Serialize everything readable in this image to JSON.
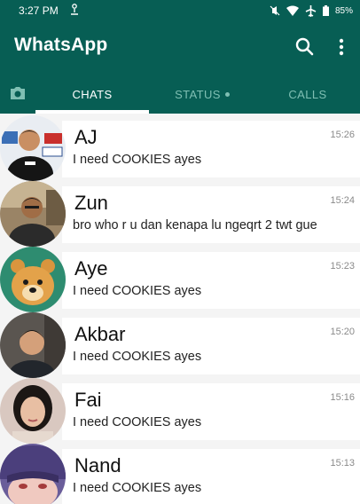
{
  "status_bar": {
    "time": "3:27 PM",
    "battery": "85%",
    "icons": [
      "notification-icon",
      "mute-icon",
      "wifi-icon",
      "airplane-icon",
      "battery-icon"
    ]
  },
  "app_bar": {
    "title": "WhatsApp",
    "actions": [
      "search-icon",
      "more-options-icon"
    ]
  },
  "tabs": {
    "camera_icon": "camera-icon",
    "chats": "CHATS",
    "status": "STATUS",
    "calls": "CALLS",
    "active": "CHATS"
  },
  "colors": {
    "header": "#075e54",
    "active_tab": "#ffffff",
    "inactive_tab": "#7fbfb3",
    "timestamp": "#8a8a8a"
  },
  "chats": [
    {
      "name": "AJ",
      "message": "I need COOKIES ayes",
      "time": "15:26"
    },
    {
      "name": "Zun",
      "message": "bro who r u dan kenapa lu ngeqrt 2 twt gue",
      "time": "15:24"
    },
    {
      "name": "Aye",
      "message": "I need COOKIES ayes",
      "time": "15:23"
    },
    {
      "name": "Akbar",
      "message": "I need COOKIES ayes",
      "time": "15:20"
    },
    {
      "name": "Fai",
      "message": "I need COOKIES ayes",
      "time": "15:16"
    },
    {
      "name": "Nand",
      "message": "I need COOKIES ayes",
      "time": "15:13"
    }
  ]
}
